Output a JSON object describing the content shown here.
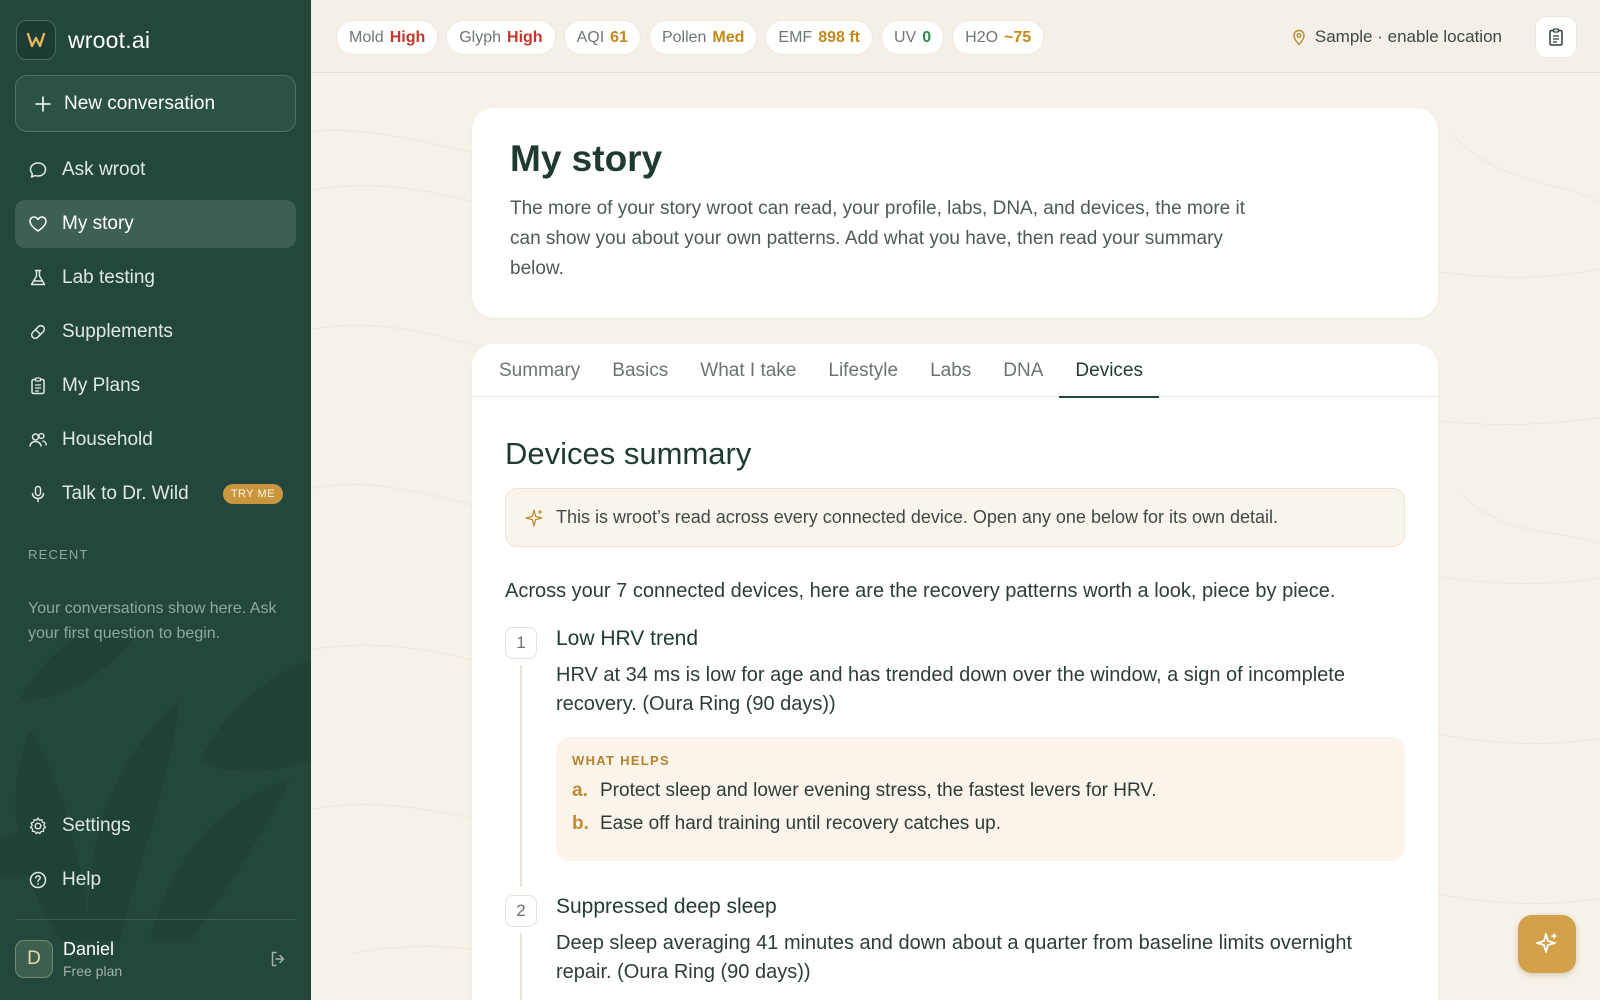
{
  "brand": {
    "name": "wroot.ai"
  },
  "sidebar": {
    "new_conversation": "New conversation",
    "items": [
      {
        "label": "Ask wroot",
        "icon": "chat-bubble-icon"
      },
      {
        "label": "My story",
        "icon": "heart-icon",
        "active": true
      },
      {
        "label": "Lab testing",
        "icon": "flask-icon"
      },
      {
        "label": "Supplements",
        "icon": "pill-icon"
      },
      {
        "label": "My Plans",
        "icon": "clipboard-icon"
      },
      {
        "label": "Household",
        "icon": "users-icon"
      },
      {
        "label": "Talk to Dr. Wild",
        "icon": "microphone-icon",
        "badge": "TRY ME"
      }
    ],
    "recent_label": "RECENT",
    "recent_empty": "Your conversations show here. Ask your first question to begin.",
    "bottom_items": [
      {
        "label": "Settings",
        "icon": "gear-icon"
      },
      {
        "label": "Help",
        "icon": "help-circle-icon"
      }
    ],
    "user": {
      "initial": "D",
      "name": "Daniel",
      "plan": "Free plan"
    }
  },
  "topbar": {
    "chips": [
      {
        "label": "Mold",
        "value": "High",
        "color": "#c0392b"
      },
      {
        "label": "Glyph",
        "value": "High",
        "color": "#c0392b"
      },
      {
        "label": "AQI",
        "value": "61",
        "color": "#c28a1a"
      },
      {
        "label": "Pollen",
        "value": "Med",
        "color": "#c28a1a"
      },
      {
        "label": "EMF",
        "value": "898 ft",
        "color": "#c28a1a"
      },
      {
        "label": "UV",
        "value": "0",
        "color": "#2f8a4e"
      },
      {
        "label": "H2O",
        "value": "~75",
        "color": "#c28a1a"
      }
    ],
    "location": "Sample · enable location"
  },
  "page": {
    "title": "My story",
    "description": "The more of your story wroot can read, your profile, labs, DNA, and devices, the more it can show you about your own patterns. Add what you have, then read your summary below."
  },
  "tabs": [
    {
      "label": "Summary"
    },
    {
      "label": "Basics"
    },
    {
      "label": "What I take"
    },
    {
      "label": "Lifestyle"
    },
    {
      "label": "Labs"
    },
    {
      "label": "DNA"
    },
    {
      "label": "Devices",
      "active": true
    }
  ],
  "devices": {
    "title": "Devices summary",
    "notice": "This is wroot’s read across every connected device. Open any one below for its own detail.",
    "intro": "Across your 7 connected devices, here are the recovery patterns worth a look, piece by piece.",
    "items": [
      {
        "number": "1",
        "title": "Low HRV trend",
        "text": "HRV at 34 ms is low for age and has trended down over the window, a sign of incomplete recovery. (Oura Ring (90 days))",
        "helps_label": "WHAT HELPS",
        "helps": [
          {
            "letter": "a.",
            "text": "Protect sleep and lower evening stress, the fastest levers for HRV."
          },
          {
            "letter": "b.",
            "text": "Ease off hard training until recovery catches up."
          }
        ]
      },
      {
        "number": "2",
        "title": "Suppressed deep sleep",
        "text": "Deep sleep averaging 41 minutes and down about a quarter from baseline limits overnight repair. (Oura Ring (90 days))"
      }
    ]
  },
  "colors": {
    "sidebar_bg": "#24473d",
    "accent_gold": "#c9963f",
    "page_bg": "#f7f2e9"
  }
}
